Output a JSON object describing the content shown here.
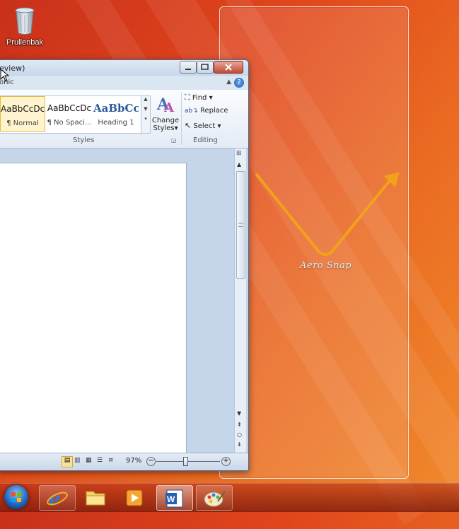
{
  "desktop": {
    "icons": [
      {
        "label": "Prullenbak",
        "icon": "recycle-bin-icon"
      }
    ]
  },
  "snap_overlay": {
    "caption": "Aero Snap"
  },
  "word_window": {
    "title_fragment": "eview)",
    "tab_fragment": "onic",
    "help_glyph": "?",
    "styles": [
      {
        "sample": "AaBbCcDc",
        "name": "¶ Normal",
        "selected": true
      },
      {
        "sample": "AaBbCcDc",
        "name": "¶ No Spaci...",
        "selected": false
      },
      {
        "sample": "AaBbCc",
        "name": "Heading 1",
        "selected": false
      }
    ],
    "change_styles_label_1": "Change",
    "change_styles_label_2": "Styles",
    "styles_group_label": "Styles",
    "editing": {
      "find_label": "Find",
      "replace_label": "Replace",
      "select_label": "Select",
      "group_label": "Editing"
    },
    "status": {
      "zoom": "97%",
      "zoom_level": 0.45
    }
  },
  "taskbar": {
    "items": [
      {
        "name": "start-button",
        "icon": "windows-orb-icon"
      },
      {
        "name": "internet-explorer",
        "icon": "internet-explorer-icon",
        "state": "open"
      },
      {
        "name": "windows-explorer",
        "icon": "folder-icon",
        "state": "pinned"
      },
      {
        "name": "media-player",
        "icon": "media-player-icon",
        "state": "pinned"
      },
      {
        "name": "microsoft-word",
        "icon": "word-icon",
        "state": "active"
      },
      {
        "name": "paint",
        "icon": "paint-icon",
        "state": "open"
      }
    ]
  },
  "colors": {
    "accent_orange": "#f0a020",
    "caption": "#d8ecf6"
  }
}
